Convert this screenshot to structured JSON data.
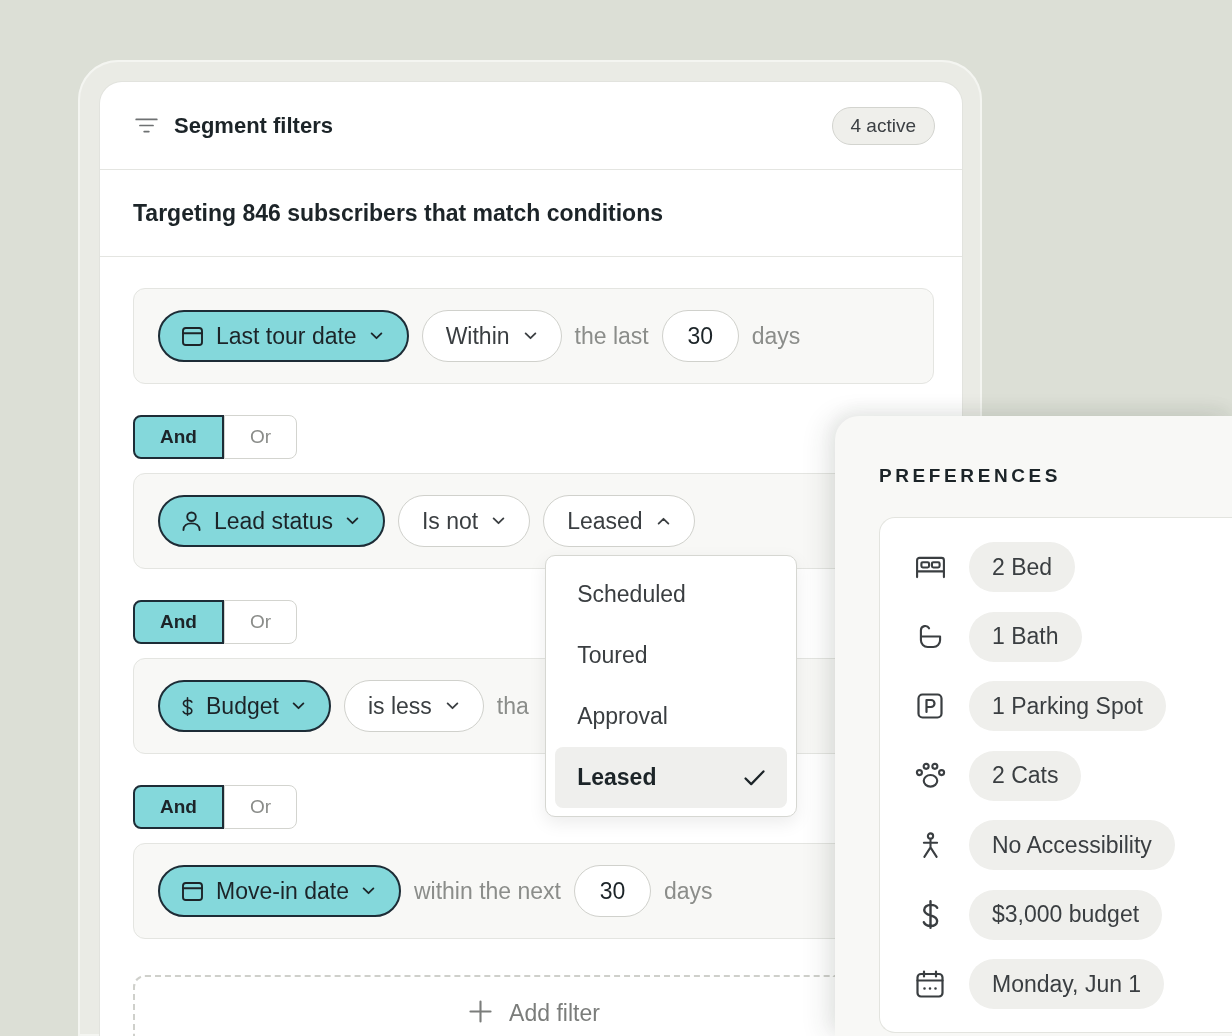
{
  "card": {
    "title": "Segment filters",
    "badge": "4 active",
    "summary": "Targeting 846 subscribers that match conditions"
  },
  "filters": [
    {
      "field": {
        "kind": "date",
        "label": "Last tour date"
      },
      "parts": [
        {
          "kind": "select",
          "text": "Within",
          "open": false
        },
        {
          "kind": "text",
          "text": "the last"
        },
        {
          "kind": "input",
          "value": "30"
        },
        {
          "kind": "text",
          "text": "days"
        }
      ]
    },
    {
      "logic": [
        {
          "label": "And",
          "selected": true
        },
        {
          "label": "Or",
          "selected": false
        }
      ],
      "field": {
        "kind": "person",
        "label": "Lead status"
      },
      "parts": [
        {
          "kind": "select",
          "text": "Is not",
          "open": false
        },
        {
          "kind": "select",
          "text": "Leased",
          "open": true,
          "options": [
            {
              "label": "Scheduled",
              "selected": false
            },
            {
              "label": "Toured",
              "selected": false
            },
            {
              "label": "Approval",
              "selected": false
            },
            {
              "label": "Leased",
              "selected": true
            }
          ]
        }
      ]
    },
    {
      "logic": [
        {
          "label": "And",
          "selected": true
        },
        {
          "label": "Or",
          "selected": false
        }
      ],
      "field": {
        "kind": "money",
        "label": "Budget"
      },
      "parts": [
        {
          "kind": "select",
          "text": "is less",
          "open": false
        },
        {
          "kind": "text",
          "text": "tha"
        }
      ]
    },
    {
      "logic": [
        {
          "label": "And",
          "selected": true
        },
        {
          "label": "Or",
          "selected": false
        }
      ],
      "field": {
        "kind": "date",
        "label": "Move-in date"
      },
      "parts": [
        {
          "kind": "text",
          "text": "within the next"
        },
        {
          "kind": "input",
          "value": "30"
        },
        {
          "kind": "text",
          "text": "days"
        }
      ]
    }
  ],
  "add_filter": {
    "label": "Add filter"
  },
  "preferences": {
    "title": "PREFERENCES",
    "items": [
      {
        "kind": "bed",
        "label": "2 Bed"
      },
      {
        "kind": "bath",
        "label": "1 Bath"
      },
      {
        "kind": "parking",
        "label": "1 Parking Spot"
      },
      {
        "kind": "pets",
        "label": "2 Cats"
      },
      {
        "kind": "accessibility",
        "label": "No Accessibility"
      },
      {
        "kind": "budget",
        "label": "$3,000 budget"
      },
      {
        "kind": "date",
        "label": "Monday, Jun 1"
      }
    ]
  }
}
